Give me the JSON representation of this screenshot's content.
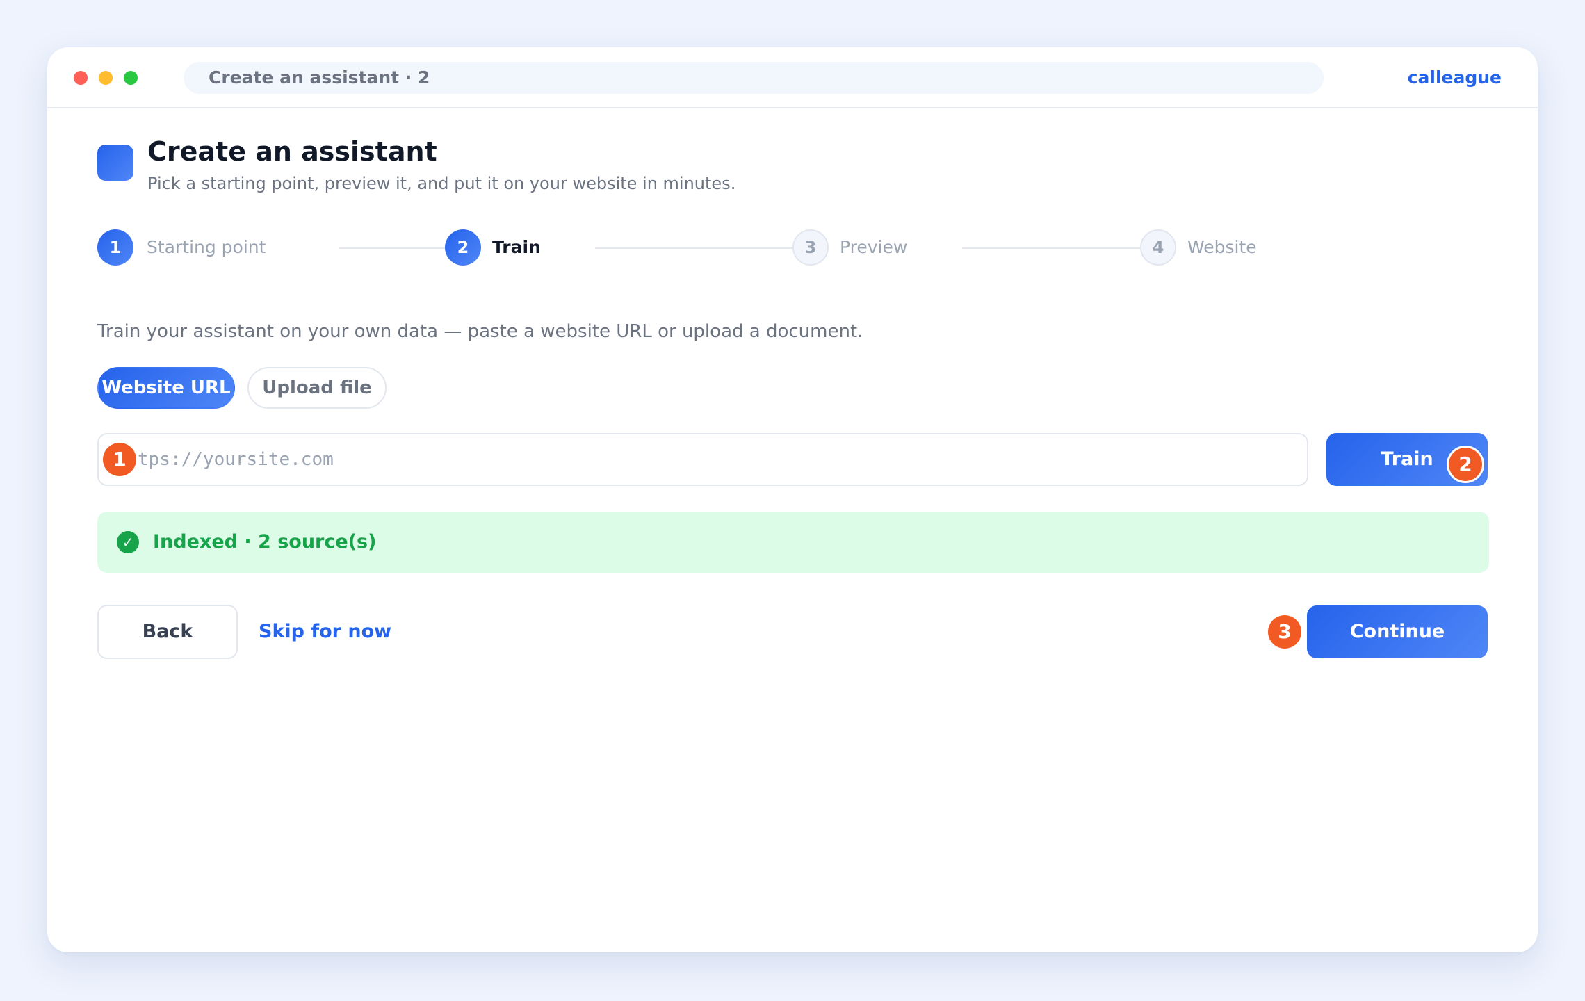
{
  "titlebar": {
    "address": "Create an assistant · 2",
    "brand": "calleague"
  },
  "header": {
    "title": "Create an assistant",
    "subtitle": "Pick a starting point, preview it, and put it on your website in minutes."
  },
  "stepper": {
    "steps": [
      {
        "number": "1",
        "label": "Starting point",
        "state": "done"
      },
      {
        "number": "2",
        "label": "Train",
        "state": "active"
      },
      {
        "number": "3",
        "label": "Preview",
        "state": "todo"
      },
      {
        "number": "4",
        "label": "Website",
        "state": "todo"
      }
    ]
  },
  "train": {
    "description": "Train your assistant on your own data — paste a website URL or upload a document.",
    "tabs": {
      "website_url": "Website URL",
      "upload_file": "Upload file"
    },
    "url_placeholder": "tps://yoursite.com",
    "train_button": "Train",
    "status": "Indexed · 2 source(s)",
    "status_icon": "check-icon"
  },
  "annotations": {
    "one": "1",
    "two": "2",
    "three": "3"
  },
  "footer": {
    "back": "Back",
    "skip": "Skip for now",
    "continue": "Continue"
  },
  "colors": {
    "accent": "#2563eb",
    "success": "#16a34a",
    "success_bg": "#dcfce7",
    "badge": "#f25a24"
  }
}
